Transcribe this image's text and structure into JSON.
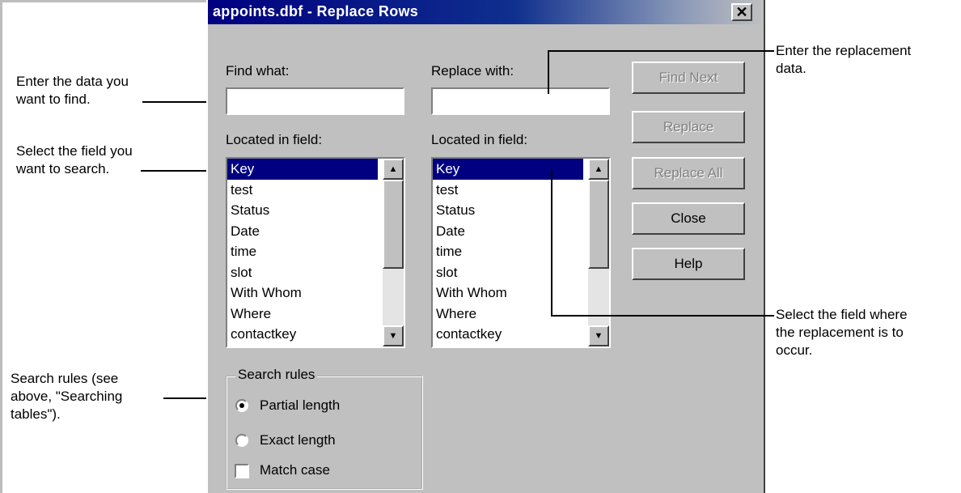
{
  "window": {
    "title": "appoints.dbf - Replace Rows",
    "close_label": "✕"
  },
  "find": {
    "label": "Find what:",
    "value": ""
  },
  "replace": {
    "label": "Replace with:",
    "value": ""
  },
  "find_field": {
    "label": "Located in field:",
    "items": [
      "Key",
      "test",
      "Status",
      "Date",
      "time",
      "slot",
      "With Whom",
      "Where",
      "contactkey"
    ],
    "selected": "Key"
  },
  "replace_field": {
    "label": "Located in field:",
    "items": [
      "Key",
      "test",
      "Status",
      "Date",
      "time",
      "slot",
      "With Whom",
      "Where",
      "contactkey"
    ],
    "selected": "Key"
  },
  "buttons": {
    "find_next": "Find Next",
    "replace": "Replace",
    "replace_all": "Replace All",
    "close": "Close",
    "help": "Help"
  },
  "search_rules": {
    "title": "Search rules",
    "partial": "Partial length",
    "exact": "Exact length",
    "match_case": "Match case",
    "selected": "partial",
    "match_case_checked": false
  },
  "annotations": {
    "find_data": "Enter the data you\nwant to find.",
    "select_field": "Select the field you\nwant to search.",
    "search_rules": "Search rules (see\nabove, \"Searching\ntables\").",
    "replacement_data": "Enter the replacement\ndata.",
    "replacement_field": "Select the field where\nthe replacement is to\noccur."
  },
  "colors": {
    "dialog_bg": "#c0c0c0",
    "title_bar": "#000080",
    "selection": "#000080"
  },
  "icons": {
    "close": "close-icon",
    "scroll_up": "scroll-up-arrow-icon",
    "scroll_down": "scroll-down-arrow-icon"
  }
}
